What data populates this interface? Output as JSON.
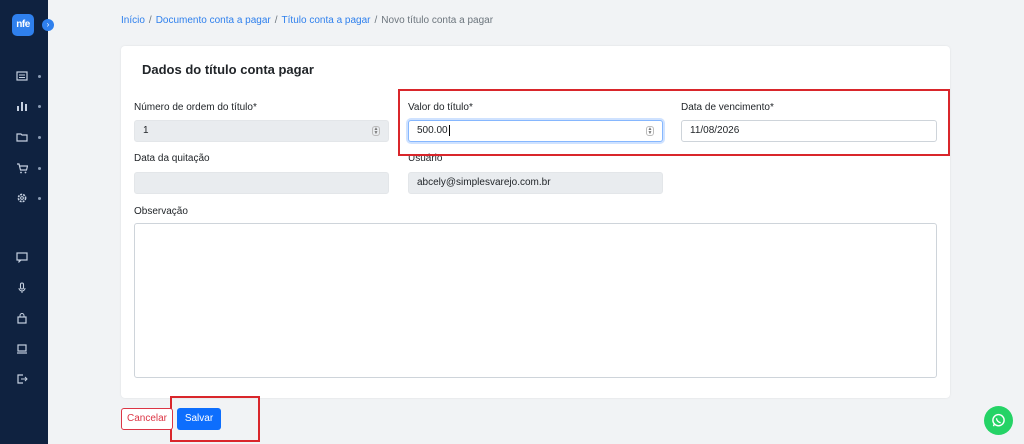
{
  "sidebar": {
    "logo": "nfe",
    "expand_glyph": "›",
    "items": [
      {
        "icon": "list-icon"
      },
      {
        "icon": "bar-chart-icon"
      },
      {
        "icon": "folder-icon"
      },
      {
        "icon": "cart-icon"
      },
      {
        "icon": "gear-icon"
      },
      {
        "icon": "message-icon"
      },
      {
        "icon": "microphone-icon"
      },
      {
        "icon": "lock-icon"
      },
      {
        "icon": "laptop-icon"
      },
      {
        "icon": "logout-icon"
      }
    ]
  },
  "breadcrumb": {
    "items": [
      "Início",
      "Documento conta a pagar",
      "Título conta a pagar"
    ],
    "current": "Novo título conta a pagar",
    "separator": "/"
  },
  "form": {
    "title": "Dados do título conta pagar",
    "numero_ordem": {
      "label": "Número de ordem do título*",
      "value": "1"
    },
    "valor": {
      "label": "Valor do título*",
      "value": "500.00"
    },
    "vencimento": {
      "label": "Data de vencimento*",
      "value": "11/08/2026"
    },
    "quitacao": {
      "label": "Data da quitação",
      "value": ""
    },
    "usuario": {
      "label": "Usuário",
      "value": "abcely@simplesvarejo.com.br"
    },
    "observacao": {
      "label": "Observação",
      "value": ""
    }
  },
  "actions": {
    "cancel_label": "Cancelar",
    "save_label": "Salvar"
  },
  "colors": {
    "sidebar_bg": "#0f2240",
    "primary": "#0d6efd",
    "danger": "#dc3545",
    "highlight": "#d9262b",
    "whatsapp": "#25d366"
  }
}
